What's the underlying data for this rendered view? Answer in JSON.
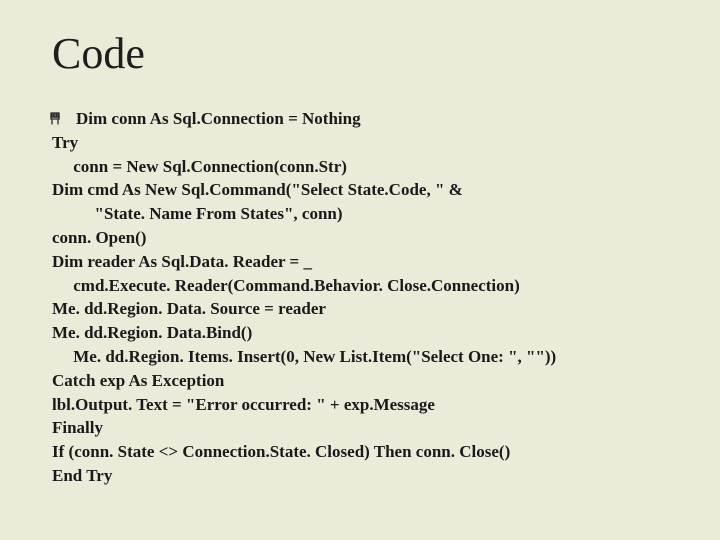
{
  "title": "Code",
  "code_lines": [
    "Dim conn As Sql.Connection = Nothing",
    "Try",
    "     conn = New Sql.Connection(conn.Str)",
    "Dim cmd As New Sql.Command(\"Select State.Code, \" &",
    "          \"State. Name From States\", conn)",
    "conn. Open()",
    "Dim reader As Sql.Data. Reader = _",
    "     cmd.Execute. Reader(Command.Behavior. Close.Connection)",
    "Me. dd.Region. Data. Source = reader",
    "Me. dd.Region. Data.Bind()",
    "     Me. dd.Region. Items. Insert(0, New List.Item(\"Select One: \", \"\"))",
    "Catch exp As Exception",
    "lbl.Output. Text = \"Error occurred: \" + exp.Message",
    "Finally",
    "If (conn. State <> Connection.State. Closed) Then conn. Close()",
    "End Try"
  ]
}
